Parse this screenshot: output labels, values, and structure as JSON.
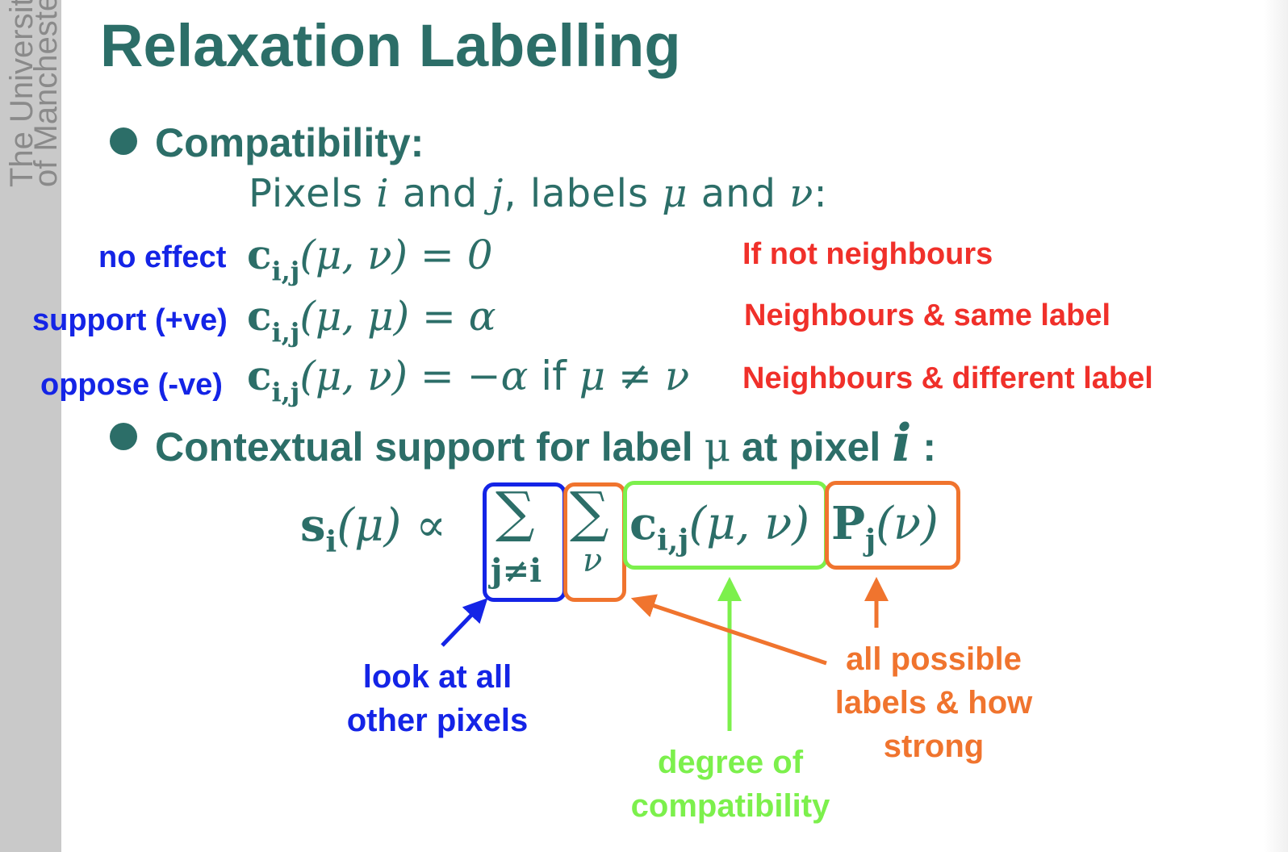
{
  "sidebar": {
    "university_line1": "The University",
    "university_line2": "of Manchester"
  },
  "title": "Relaxation Labelling",
  "bullet1": {
    "heading": "Compatibility:",
    "subline_prefix": "Pixels ",
    "subline_i": "i",
    "subline_and1": " and ",
    "subline_j": "j",
    "subline_labels": ", labels ",
    "subline_mu": "μ",
    "subline_and2": " and ",
    "subline_nu": "ν",
    "subline_colon": ":"
  },
  "rules": [
    {
      "label": "no effect",
      "equation_lhs": "c",
      "equation_sub": "i,j",
      "equation_args": "(μ, ν) = 0",
      "condition": "If not neighbours"
    },
    {
      "label": "support (+ve)",
      "equation_lhs": "c",
      "equation_sub": "i,j",
      "equation_args": "(μ, μ) = α",
      "condition": "Neighbours & same label"
    },
    {
      "label": "oppose (-ve)",
      "equation_lhs": "c",
      "equation_sub": "i,j",
      "equation_args": "(μ, ν) = −α",
      "equation_if": " if ",
      "equation_cond": "μ ≠ ν",
      "condition": "Neighbours & different label"
    }
  ],
  "bullet2": {
    "heading_prefix": "Contextual support for label ",
    "heading_mu": "μ",
    "heading_mid": " at pixel ",
    "heading_i": "i",
    "heading_colon": " :"
  },
  "formula": {
    "s": "s",
    "s_sub": "i",
    "s_args": "(μ) ∝",
    "sum1": "∑",
    "sum1_sub": "j≠i",
    "sum2": "∑",
    "sum2_sub": "ν",
    "c": "c",
    "c_sub": "i,j",
    "c_args": "(μ, ν)",
    "p": "P",
    "p_sub": "j",
    "p_args": "(ν)"
  },
  "notes": {
    "blue": [
      "look at all",
      "other pixels"
    ],
    "green": [
      "degree of",
      "compatibility"
    ],
    "orange": [
      "all possible",
      "labels & how",
      "strong"
    ]
  },
  "colors": {
    "teal": "#2c6e68",
    "blue": "#1424e6",
    "red": "#f0302a",
    "orange": "#f0742e",
    "green": "#7cf04c",
    "sidebar": "#c9c9c9"
  }
}
